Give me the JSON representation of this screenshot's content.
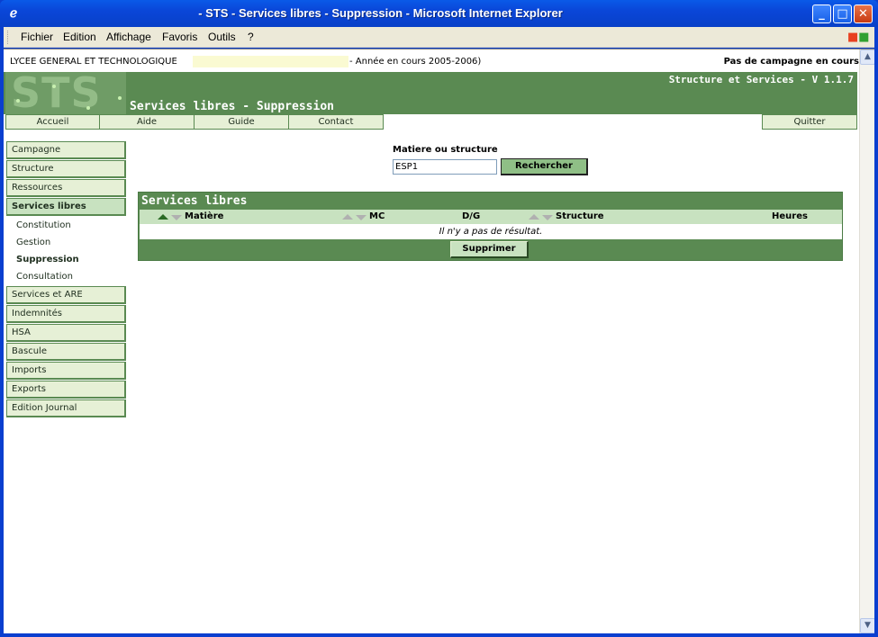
{
  "window": {
    "title": "- STS - Services libres - Suppression - Microsoft Internet Explorer",
    "minimize": "_",
    "maximize": "□",
    "close": "✕"
  },
  "menu": [
    "Fichier",
    "Edition",
    "Affichage",
    "Favoris",
    "Outils",
    "?"
  ],
  "header": {
    "school": "LYCEE GENERAL ET TECHNOLOGIQUE",
    "year": "- Année en cours 2005-2006)",
    "campaign": "Pas de campagne en cours",
    "app_version": "Structure et Services - V 1.1.7",
    "logo": "STS",
    "page_title": "Services libres - Suppression"
  },
  "topnav": {
    "accueil": "Accueil",
    "aide": "Aide",
    "guide": "Guide",
    "contact": "Contact",
    "quitter": "Quitter"
  },
  "sidebar": {
    "campagne": "Campagne",
    "structure": "Structure",
    "ressources": "Ressources",
    "services_libres": "Services libres",
    "sub": {
      "constitution": "Constitution",
      "gestion": "Gestion",
      "suppression": "Suppression",
      "consultation": "Consultation"
    },
    "services_are": "Services et ARE",
    "indemnites": "Indemnités",
    "hsa": "HSA",
    "bascule": "Bascule",
    "imports": "Imports",
    "exports": "Exports",
    "journal": "Edition Journal"
  },
  "search": {
    "label": "Matiere ou structure",
    "value": "ESP1",
    "button": "Rechercher"
  },
  "results": {
    "title": "Services libres",
    "columns": {
      "matiere": "Matière",
      "mc": "MC",
      "dg": "D/G",
      "structure": "Structure",
      "heures": "Heures"
    },
    "empty": "Il n'y a pas de résultat.",
    "delete_button": "Supprimer"
  },
  "colors": {
    "brand_green": "#5a8a52",
    "light_green": "#e6f0d6",
    "active_green": "#c8e2c0"
  }
}
